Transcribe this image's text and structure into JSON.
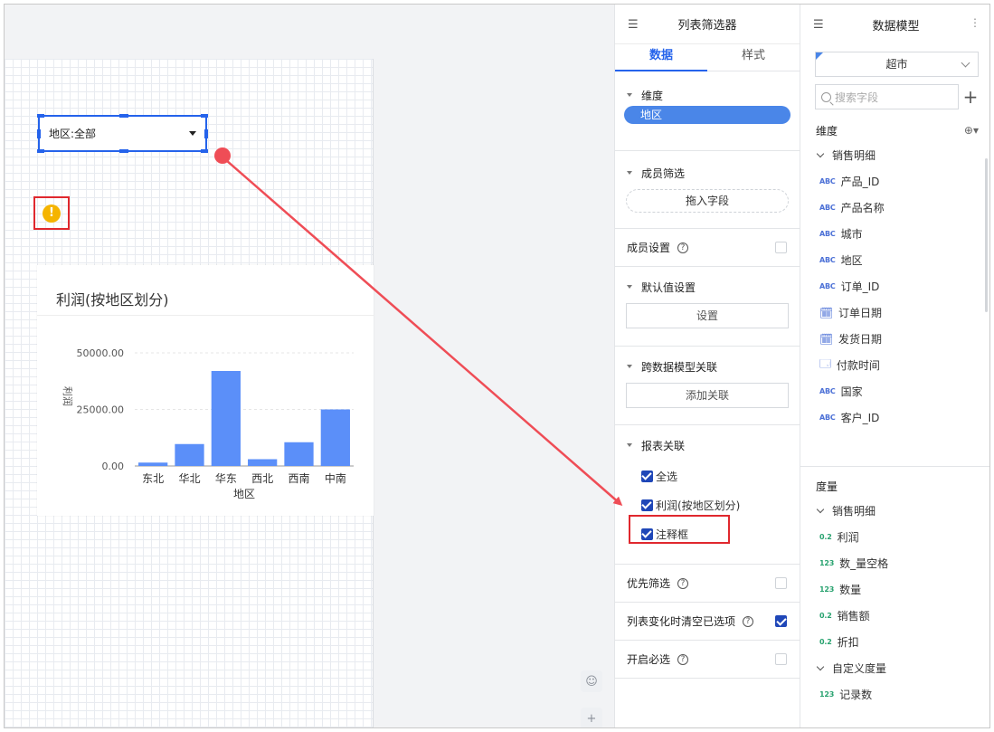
{
  "canvas": {
    "selector_label": "地区:全部",
    "chart_title": "利润(按地区划分)"
  },
  "chart_data": {
    "type": "bar",
    "categories": [
      "东北",
      "华北",
      "华东",
      "西北",
      "西南",
      "中南"
    ],
    "values": [
      1500,
      9700,
      42000,
      3000,
      10500,
      25000
    ],
    "ylabel": "利润",
    "xlabel": "地区",
    "yticks": [
      "0.00",
      "25000.00",
      "50000.00"
    ],
    "ylim": [
      0,
      50000
    ],
    "bar_color": "#5b8ff9",
    "grid": "dashed horizontal"
  },
  "filter_panel": {
    "title": "列表筛选器",
    "tabs": [
      "数据",
      "样式"
    ],
    "dimension_label": "维度",
    "dimension_field": "地区",
    "member_filter_label": "成员筛选",
    "drop_field_label": "拖入字段",
    "member_settings_label": "成员设置",
    "default_value_label": "默认值设置",
    "settings_button": "设置",
    "cross_model_label": "跨数据模型关联",
    "add_relation_button": "添加关联",
    "report_relation_label": "报表关联",
    "report_items": [
      "全选",
      "利润(按地区划分)",
      "注释框"
    ],
    "priority_filter_label": "优先筛选",
    "clear_on_change_label": "列表变化时清空已选项",
    "required_label": "开启必选",
    "help_glyph": "?"
  },
  "model_panel": {
    "title": "数据模型",
    "model_name": "超市",
    "search_placeholder": "搜索字段",
    "dimension_head": "维度",
    "dimension_group": "销售明细",
    "dimension_fields": [
      {
        "tag": "ABC",
        "name": "产品_ID"
      },
      {
        "tag": "ABC",
        "name": "产品名称"
      },
      {
        "tag": "ABC",
        "name": "城市"
      },
      {
        "tag": "ABC",
        "name": "地区"
      },
      {
        "tag": "ABC",
        "name": "订单_ID"
      },
      {
        "tag": "date",
        "name": "订单日期"
      },
      {
        "tag": "date",
        "name": "发货日期"
      },
      {
        "tag": "datetime",
        "name": "付款时间"
      },
      {
        "tag": "ABC",
        "name": "国家"
      },
      {
        "tag": "ABC",
        "name": "客户_ID"
      }
    ],
    "measure_head": "度量",
    "measure_group": "销售明细",
    "measure_fields": [
      {
        "tag": "0.2",
        "name": "利润"
      },
      {
        "tag": "123",
        "name": "数_量空格"
      },
      {
        "tag": "123",
        "name": "数量"
      },
      {
        "tag": "0.2",
        "name": "销售额"
      },
      {
        "tag": "0.2",
        "name": "折扣"
      }
    ],
    "custom_group": "自定义度量",
    "custom_fields": [
      {
        "tag": "123",
        "name": "记录数"
      }
    ]
  },
  "colors": {
    "accent": "#2563eb",
    "pill": "#4a86e8",
    "checkbox": "#1f47b8",
    "highlight": "#e0282e",
    "warning": "#f5b400"
  }
}
